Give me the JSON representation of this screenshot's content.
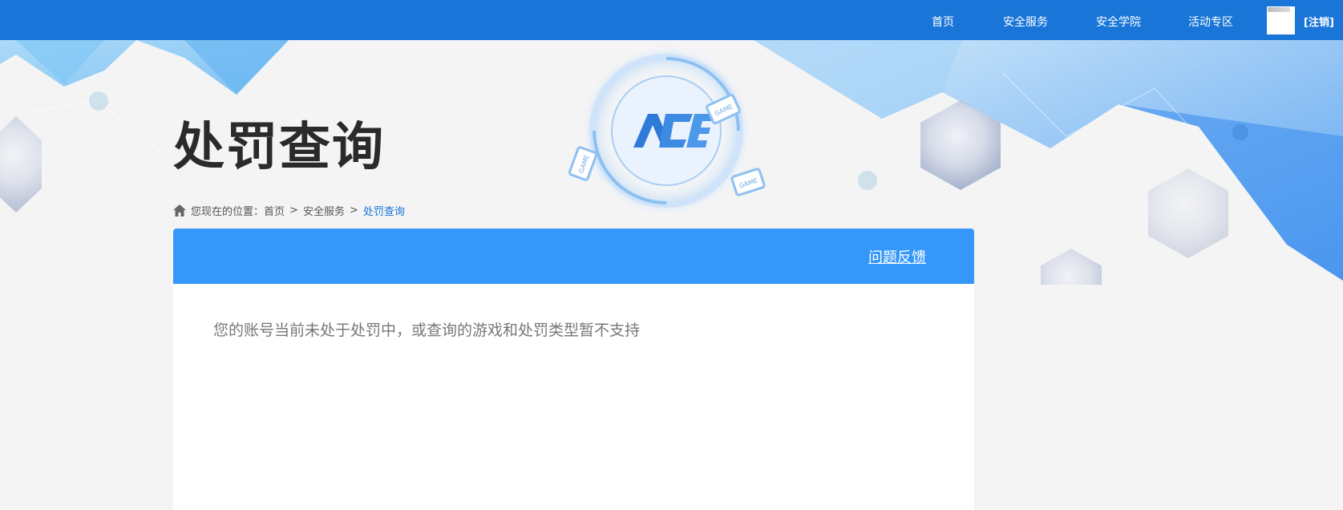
{
  "nav": {
    "items": [
      "首页",
      "安全服务",
      "安全学院",
      "活动专区"
    ],
    "logout": "[注销]"
  },
  "banner": {
    "badge_text": "GAME",
    "logo_text": "ACE"
  },
  "page_title": "处罚查询",
  "breadcrumb": {
    "prefix": "您现在的位置：",
    "home": "首页",
    "section": "安全服务",
    "current": "处罚查询",
    "separator": ">"
  },
  "panel": {
    "feedback_link": "问题反馈",
    "message": "您的账号当前未处于处罚中，或查询的游戏和处罚类型暂不支持"
  },
  "colors": {
    "topbar": "#1976d8",
    "panel_header": "#3597fa",
    "breadcrumb_current": "#1976d8"
  }
}
